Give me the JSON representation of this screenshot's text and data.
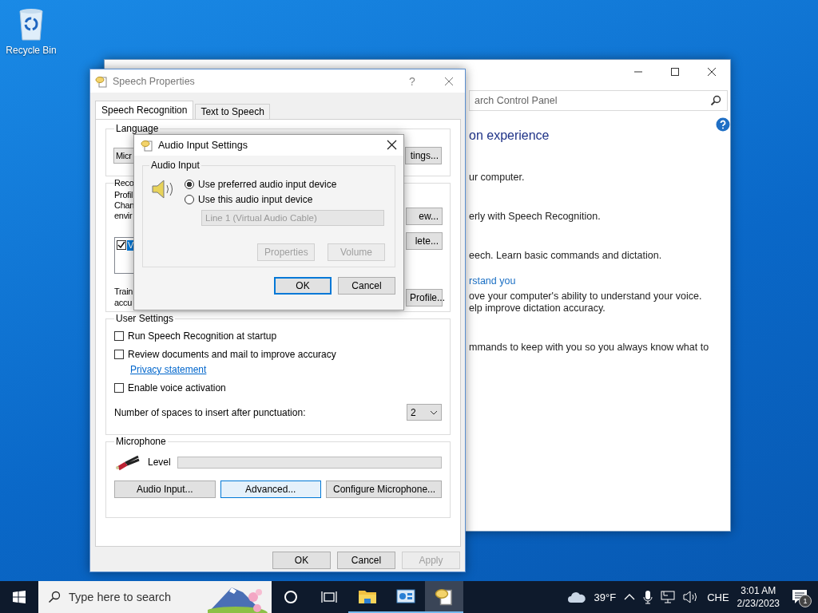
{
  "desktop_icons": [
    {
      "label": "Recycle Bin"
    }
  ],
  "control_panel": {
    "search": {
      "placeholder": "arch Control Panel"
    },
    "heading": "on experience",
    "lines": [
      {
        "kind": "text",
        "text": "ur computer."
      },
      {
        "kind": "text",
        "text": "erly with Speech Recognition."
      },
      {
        "kind": "text",
        "text": "eech.  Learn basic commands and dictation."
      },
      {
        "kind": "link",
        "text": "rstand you"
      },
      {
        "kind": "text",
        "text": "ove your computer's ability to understand your voice."
      },
      {
        "kind": "text",
        "text": "elp improve dictation accuracy."
      },
      {
        "kind": "text",
        "text": "mmands to keep with you so you always know what to"
      }
    ]
  },
  "speech_properties": {
    "title": "Speech Properties",
    "help": "?",
    "tabs": [
      {
        "label": "Speech Recognition",
        "selected": true
      },
      {
        "label": "Text to Speech",
        "selected": false
      }
    ],
    "language": {
      "label": "Language",
      "combo_value": "Micr",
      "settings_button": "tings..."
    },
    "profiles": {
      "label": "Reco",
      "description": [
        "Profil",
        "Chan",
        "envir"
      ],
      "buttons": [
        "ew...",
        "lete..."
      ],
      "list_item": {
        "text": "V",
        "checked": true,
        "selected": true
      },
      "training": [
        "Train",
        "accu"
      ],
      "train_button": "Profile..."
    },
    "user_settings": {
      "label": "User Settings",
      "options": [
        {
          "kind": "checkbox",
          "label": "Run Speech Recognition at startup",
          "checked": false
        },
        {
          "kind": "checkbox",
          "label": "Review documents and mail to improve accuracy",
          "checked": false
        },
        {
          "kind": "link",
          "label": "Privacy statement"
        },
        {
          "kind": "checkbox",
          "label": "Enable voice activation",
          "checked": false
        }
      ],
      "spaces_label": "Number of spaces to insert after punctuation:",
      "spaces_value": "2"
    },
    "microphone": {
      "label": "Microphone",
      "level_label": "Level",
      "buttons": [
        {
          "label": "Audio Input...",
          "hovered": false
        },
        {
          "label": "Advanced...",
          "hovered": true
        },
        {
          "label": "Configure Microphone...",
          "hovered": false
        }
      ]
    },
    "buttons": [
      {
        "label": "OK",
        "disabled": false
      },
      {
        "label": "Cancel",
        "disabled": false
      },
      {
        "label": "Apply",
        "disabled": true
      }
    ]
  },
  "audio_input_dialog": {
    "title": "Audio Input Settings",
    "group": "Audio Input",
    "radios": [
      {
        "label": "Use preferred audio input device",
        "selected": true
      },
      {
        "label": "Use this audio input device",
        "selected": false
      }
    ],
    "device": {
      "value": "Line 1 (Virtual Audio Cable)",
      "disabled": true
    },
    "device_buttons": [
      {
        "label": "Properties",
        "disabled": true
      },
      {
        "label": "Volume",
        "disabled": true
      }
    ],
    "buttons": [
      {
        "label": "OK",
        "default": true
      },
      {
        "label": "Cancel",
        "default": false
      }
    ]
  },
  "taskbar": {
    "search": {
      "placeholder": "Type here to search"
    },
    "apps": [
      {
        "kind": "folder",
        "active": false
      },
      {
        "kind": "panel",
        "active": false
      },
      {
        "kind": "speech",
        "active": true
      }
    ],
    "weather": "39°F",
    "language": "CHE",
    "time": "3:01 AM",
    "date": "2/23/2023",
    "notifications": "1"
  }
}
